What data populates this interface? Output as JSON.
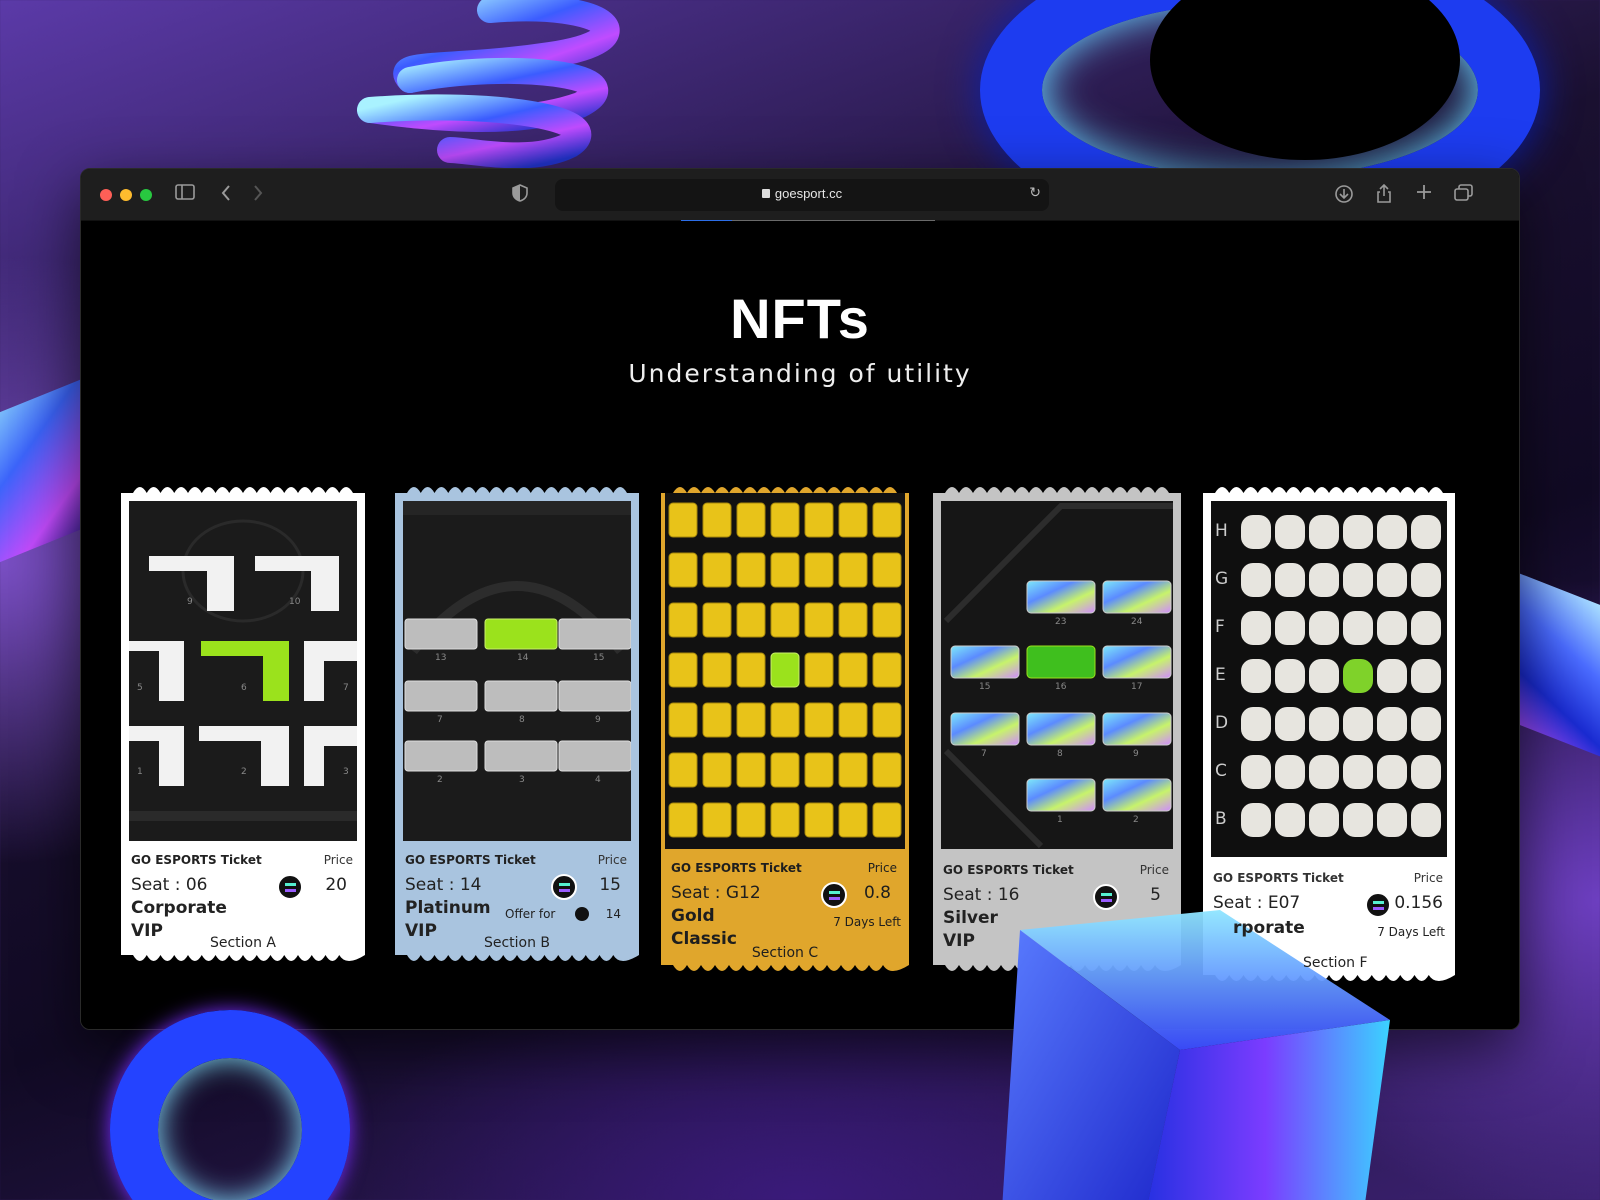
{
  "browser": {
    "url": "goesport.cc",
    "progress": 0.2
  },
  "page": {
    "title": "NFTs",
    "subtitle": "Understanding of utility"
  },
  "tickets": [
    {
      "title": "GO ESPORTS Ticket",
      "price_label": "Price",
      "seat": "Seat : 06",
      "price": "20",
      "tier_line1": "Corporate",
      "tier_line2": "VIP",
      "section": "Section A",
      "color": "#ffffff",
      "seat_numbers": [
        "9",
        "10",
        "5",
        "6",
        "7",
        "1",
        "2",
        "3"
      ]
    },
    {
      "title": "GO ESPORTS Ticket",
      "price_label": "Price",
      "seat": "Seat : 14",
      "price": "15",
      "tier_line1": "Platinum",
      "tier_line2": "VIP",
      "offer_label": "Offer for",
      "offer_value": "14",
      "section": "Section B",
      "color": "#a9c4df",
      "seat_numbers": [
        "13",
        "14",
        "15",
        "7",
        "8",
        "9",
        "2",
        "3",
        "4"
      ]
    },
    {
      "title": "GO ESPORTS Ticket",
      "price_label": "Price",
      "seat": "Seat : G12",
      "price": "0.8",
      "tier_line1": "Gold",
      "tier_line2": "Classic",
      "time_left": "7 Days Left",
      "section": "Section C",
      "color": "#e0a62c"
    },
    {
      "title": "GO ESPORTS Ticket",
      "price_label": "Price",
      "seat": "Seat : 16",
      "price": "5",
      "tier_line1": "Silver",
      "tier_line2": "VIP",
      "color": "#c4c4c4",
      "seat_numbers": [
        "23",
        "24",
        "15",
        "16",
        "17",
        "7",
        "8",
        "9",
        "1",
        "2"
      ]
    },
    {
      "title": "GO ESPORTS Ticket",
      "price_label": "Price",
      "seat": "Seat : E07",
      "price": "0.156",
      "tier_line1": "rporate",
      "time_left": "7 Days Left",
      "section": "Section F",
      "color": "#ffffff",
      "row_letters": [
        "H",
        "G",
        "F",
        "E",
        "D",
        "C",
        "B"
      ]
    }
  ],
  "colors": {
    "selected_seat": "#9be21c",
    "accent": "#2c6ee8"
  }
}
